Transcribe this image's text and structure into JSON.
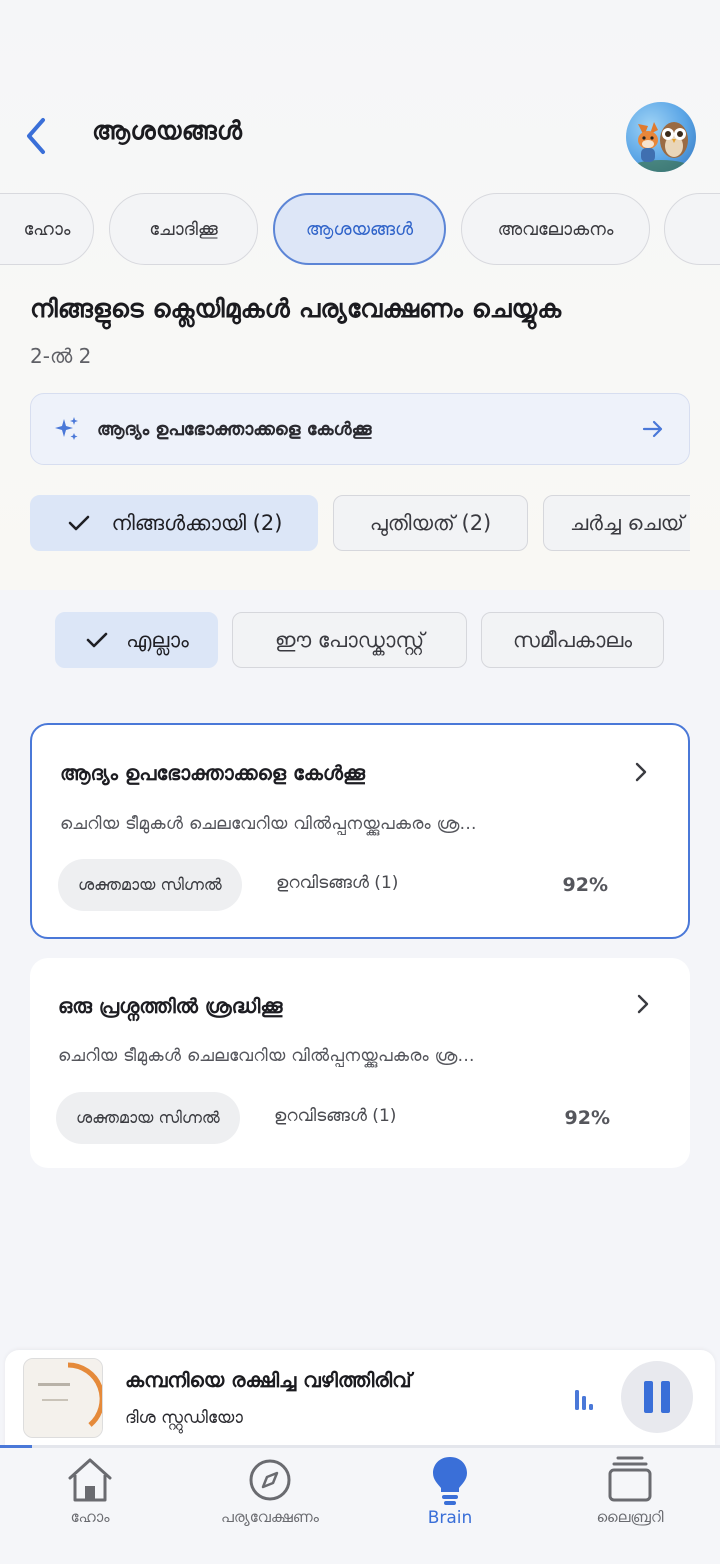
{
  "header": {
    "title": "ആശയങ്ങൾ"
  },
  "tabs": [
    {
      "label": "ഹോം"
    },
    {
      "label": "ചോദിക്കൂ"
    },
    {
      "label": "ആശയങ്ങൾ",
      "active": true
    },
    {
      "label": "അവലോകനം"
    }
  ],
  "section": {
    "title": "നിങ്ങളുടെ ക്ലെയിമുകൾ പര്യവേക്ഷണം ചെയ്യുക",
    "counter": "2-ൽ 2"
  },
  "suggestion": {
    "text": "ആദ്യം ഉപഭോക്താക്കളെ കേൾക്കൂ"
  },
  "chips": [
    {
      "label": "നിങ്ങൾക്കായി (2)",
      "selected": true
    },
    {
      "label": "പുതിയത് (2)",
      "selected": false
    },
    {
      "label": "ചർച്ച ചെയ്",
      "selected": false
    }
  ],
  "filters": [
    {
      "label": "എല്ലാം",
      "selected": true
    },
    {
      "label": "ഈ പോഡ്കാസ്റ്റ്",
      "selected": false
    },
    {
      "label": "സമീപകാലം",
      "selected": false
    }
  ],
  "cards": [
    {
      "title": "ആദ്യം ഉപഭോക്താക്കളെ കേൾക്കൂ",
      "desc": "ചെറിയ ടീമുകൾ ചെലവേറിയ വിൽപ്പനയ്ക്കുപകരം ശ്ര...",
      "badge": "ശക്തമായ സിഗ്നൽ",
      "sources": "ഉറവിടങ്ങൾ (1)",
      "percent": "92%",
      "highlighted": true
    },
    {
      "title": "ഒരു പ്രശ്നത്തിൽ ശ്രദ്ധിക്കൂ",
      "desc": "ചെറിയ ടീമുകൾ ചെലവേറിയ വിൽപ്പനയ്ക്കുപകരം ശ്ര...",
      "badge": "ശക്തമായ സിഗ്നൽ",
      "sources": "ഉറവിടങ്ങൾ (1)",
      "percent": "92%",
      "highlighted": false
    }
  ],
  "player": {
    "title": "കമ്പനിയെ രക്ഷിച്ച വഴിത്തിരിവ്",
    "subtitle": "ദിശ സ്റ്റുഡിയോ",
    "progress": 0.045
  },
  "nav": [
    {
      "label": "ഹോം",
      "icon": "home-icon"
    },
    {
      "label": "പര്യവേക്ഷണം",
      "icon": "compass-icon"
    },
    {
      "label": "Brain",
      "icon": "lightbulb-icon",
      "active": true
    },
    {
      "label": "ലൈബ്രറി",
      "icon": "library-icon"
    }
  ],
  "colors": {
    "accent": "#3a6fd8",
    "active_tab_bg": "#dde6f7",
    "card_border": "#4a78d8"
  }
}
